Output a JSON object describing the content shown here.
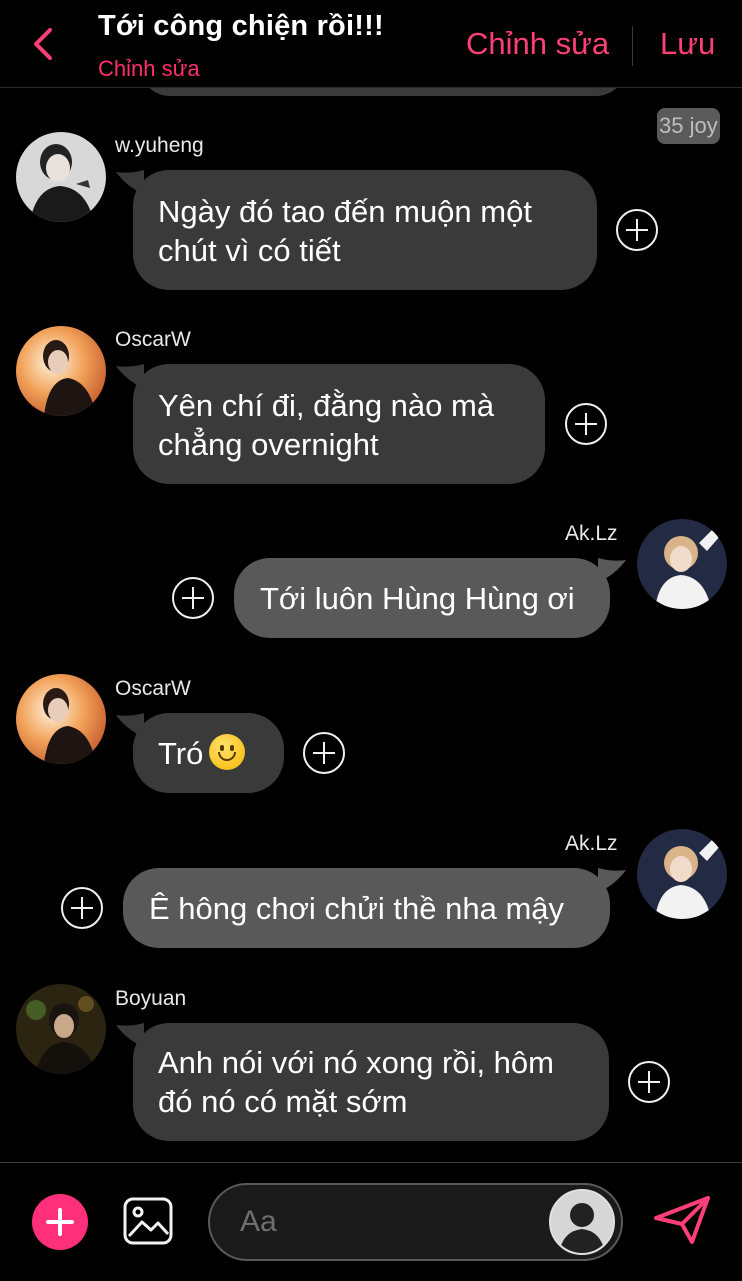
{
  "header": {
    "title": "Tới công chiện rồi!!!",
    "subtitle": "Chỉnh sửa",
    "edit_label": "Chỉnh sửa",
    "save_label": "Lưu",
    "accent": "#ff3f7a"
  },
  "time_badge": "35 joy",
  "messages": [
    {
      "sender": "w.yuheng",
      "side": "left",
      "lines": [
        "Ngày đó tao đến muộn một",
        "chút vì có tiết"
      ]
    },
    {
      "sender": "OscarW",
      "side": "left",
      "lines": [
        "Yên chí đi, đằng nào mà",
        "chẳng overnight"
      ]
    },
    {
      "sender": "Ak.Lz",
      "side": "right",
      "lines": [
        "Tới luôn Hùng Hùng ơi"
      ]
    },
    {
      "sender": "OscarW",
      "side": "left",
      "lines": [
        "Tró"
      ],
      "emoji": "slightly-smiling-face"
    },
    {
      "sender": "Ak.Lz",
      "side": "right",
      "lines": [
        "Ê hông chơi chửi thề nha mậy"
      ]
    },
    {
      "sender": "Boyuan",
      "side": "left",
      "lines": [
        "Anh nói với nó xong rồi, hôm",
        "đó nó có mặt sớm"
      ]
    }
  ],
  "composer": {
    "placeholder": "Aa",
    "add_icon": "plus-icon",
    "image_icon": "image-icon",
    "send_icon": "send-icon"
  }
}
